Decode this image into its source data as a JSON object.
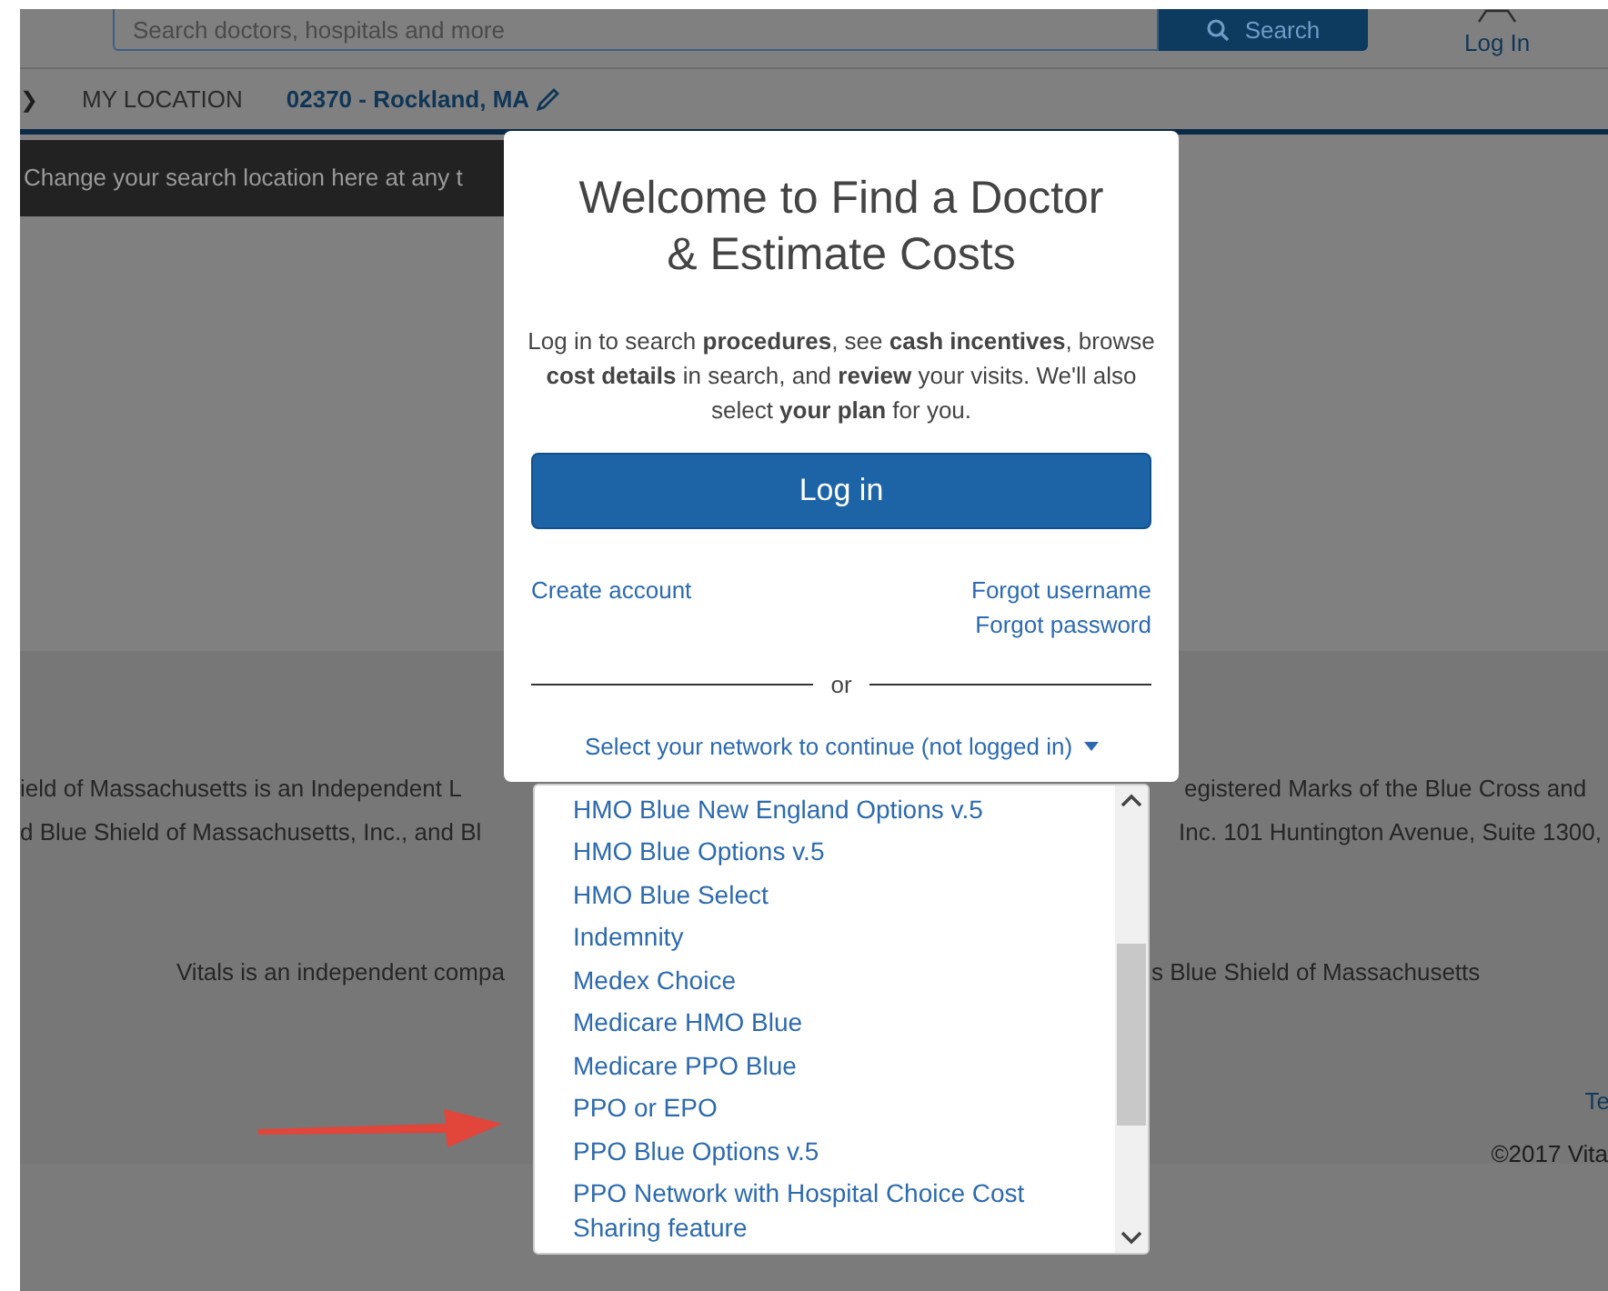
{
  "header": {
    "search": {
      "placeholder": "Search doctors, hospitals and more"
    },
    "search_button": "Search",
    "login": "Log In"
  },
  "location_bar": {
    "back": "❯",
    "label": "MY LOCATION",
    "value": "02370 - Rockland, MA"
  },
  "tooltip": {
    "text": "Change your search location here at any t"
  },
  "modal": {
    "title": "Welcome to Find a Doctor & Estimate Costs",
    "intro": "Log in to search **procedures**, see **cash incentives**, browse **cost details** in search, and **review** your visits. We'll also select **your plan** for you.",
    "login_button": "Log in",
    "create_account": "Create account",
    "forgot_username": "Forgot username",
    "forgot_password": "Forgot password",
    "divider": "or",
    "network_select": "Select your network to continue (not logged in)"
  },
  "dropdown": {
    "items": [
      {
        "label": "HMO Blue New England Options v.5"
      },
      {
        "label": "HMO Blue Options v.5"
      },
      {
        "label": "HMO Blue Select"
      },
      {
        "label": "Indemnity"
      },
      {
        "label": "Medex Choice"
      },
      {
        "label": "Medicare HMO Blue"
      },
      {
        "label": "Medicare PPO Blue"
      },
      {
        "label": "PPO or EPO"
      },
      {
        "label": "PPO Blue Options v.5"
      },
      {
        "label": "PPO Network with Hospital Choice Cost Sharing feature"
      }
    ]
  },
  "footer": {
    "rows": [
      {
        "left": "ield of Massachusetts is an Independent L",
        "right": "egistered Marks of the Blue Cross and"
      },
      {
        "left": "d Blue Shield of Massachusetts, Inc., and Bl",
        "right": "Inc. 101 Huntington Avenue, Suite 1300,"
      },
      {
        "left": "Vitals is an independent compa",
        "right": "s Blue Shield of Massachusetts"
      }
    ],
    "link": "Te",
    "copyright": "©2017 Vita"
  }
}
